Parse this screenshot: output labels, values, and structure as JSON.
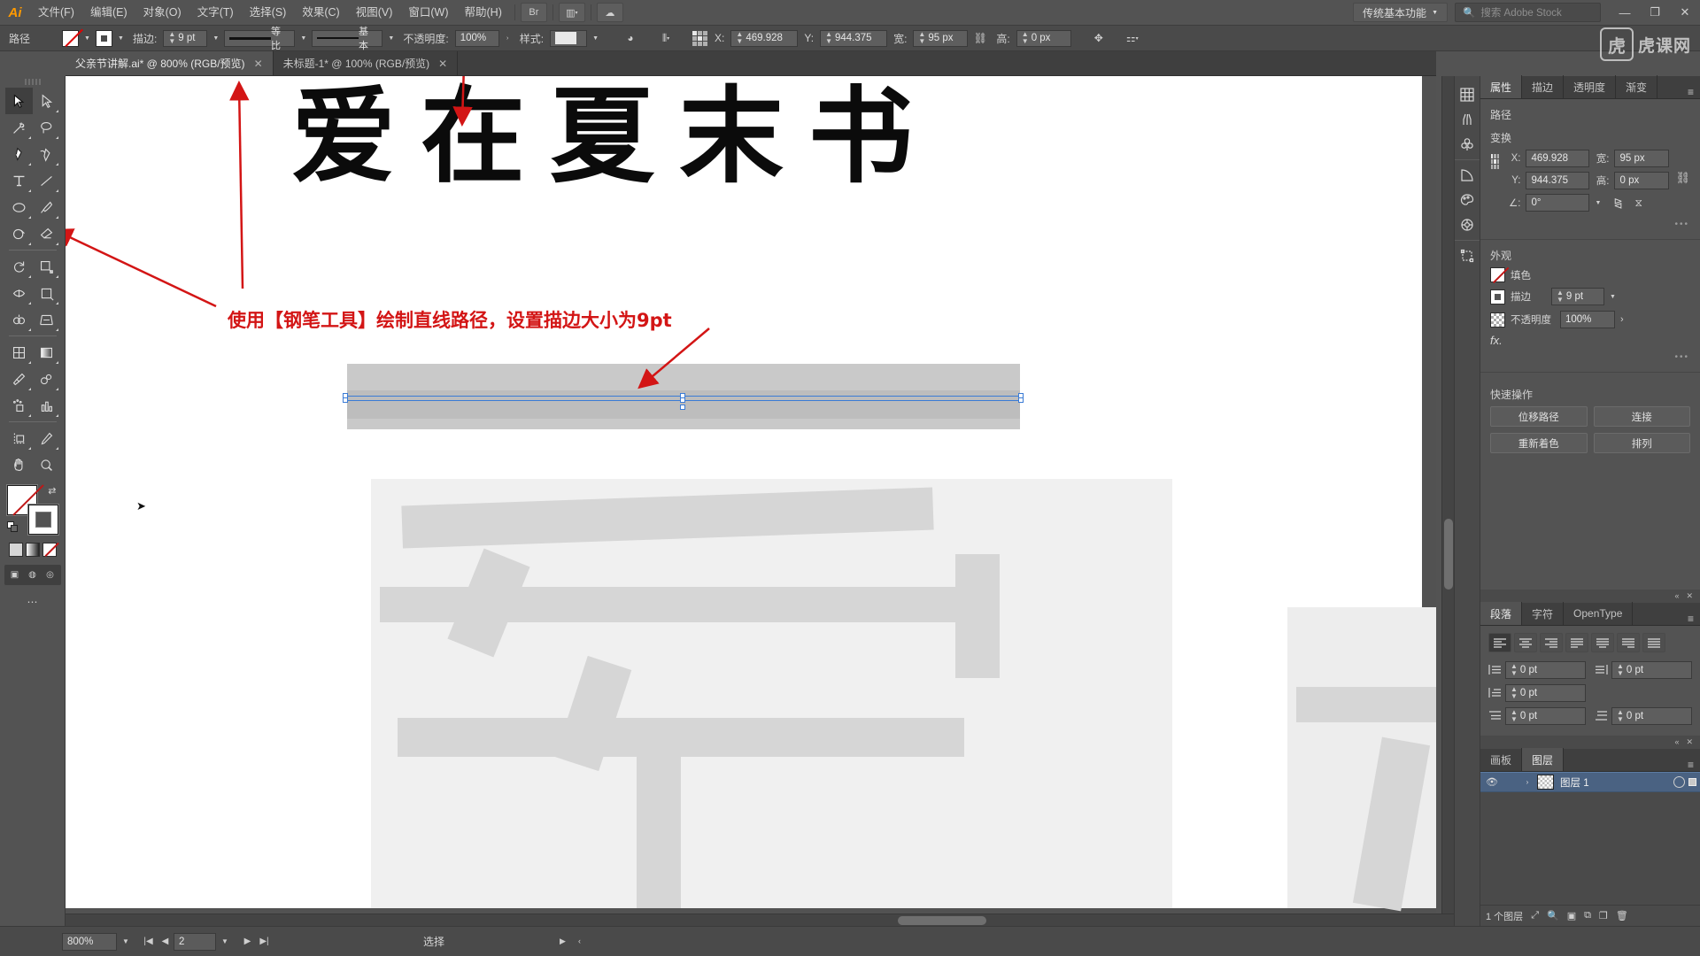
{
  "app": {
    "logo": "Ai",
    "menus": [
      "文件(F)",
      "编辑(E)",
      "对象(O)",
      "文字(T)",
      "选择(S)",
      "效果(C)",
      "视图(V)",
      "窗口(W)",
      "帮助(H)"
    ],
    "workspace": "传统基本功能",
    "stock_placeholder": "搜索 Adobe Stock",
    "win_min": "—",
    "win_max": "❐",
    "win_close": "✕"
  },
  "watermark": {
    "mark": "虎",
    "text": "虎课网"
  },
  "controlbar": {
    "object_label": "路径",
    "stroke_label": "描边:",
    "stroke_weight": "9 pt",
    "profile_variable": "等比",
    "brush_basic": "基本",
    "opacity_label": "不透明度:",
    "opacity_value": "100%",
    "style_label": "样式:",
    "x_label": "X:",
    "x_value": "469.928",
    "y_label": "Y:",
    "y_value": "944.375",
    "w_label": "宽:",
    "w_value": "95 px",
    "h_label": "高:",
    "h_value": "0 px"
  },
  "tabs": [
    {
      "title": "父亲节讲解.ai* @ 800% (RGB/预览)",
      "close": "✕",
      "active": true
    },
    {
      "title": "未标题-1* @ 100% (RGB/预览)",
      "close": "✕",
      "active": false
    }
  ],
  "toolbar": {
    "tools": [
      {
        "name": "selection-tool",
        "glyph": "sel",
        "active": true
      },
      {
        "name": "direct-selection-tool",
        "glyph": "dsel",
        "active": false
      },
      {
        "name": "magic-wand-tool",
        "glyph": "wand",
        "active": false
      },
      {
        "name": "lasso-tool",
        "glyph": "lasso",
        "active": false
      },
      {
        "name": "pen-tool",
        "glyph": "pen",
        "active": false
      },
      {
        "name": "curvature-tool",
        "glyph": "curv",
        "active": false
      },
      {
        "name": "type-tool",
        "glyph": "type",
        "active": false
      },
      {
        "name": "line-segment-tool",
        "glyph": "line",
        "active": false
      },
      {
        "name": "ellipse-tool",
        "glyph": "ellipse",
        "active": false
      },
      {
        "name": "paintbrush-tool",
        "glyph": "brush",
        "active": false
      },
      {
        "name": "shaper-tool",
        "glyph": "shaper",
        "active": false
      },
      {
        "name": "eraser-tool",
        "glyph": "eraser",
        "active": false
      },
      {
        "name": "rotate-tool",
        "glyph": "rotate",
        "active": false
      },
      {
        "name": "scale-tool",
        "glyph": "scale",
        "active": false
      },
      {
        "name": "width-tool",
        "glyph": "width",
        "active": false
      },
      {
        "name": "free-transform-tool",
        "glyph": "freetr",
        "active": false
      },
      {
        "name": "shape-builder-tool",
        "glyph": "shapeb",
        "active": false
      },
      {
        "name": "perspective-grid-tool",
        "glyph": "persp",
        "active": false
      },
      {
        "name": "mesh-tool",
        "glyph": "mesh",
        "active": false
      },
      {
        "name": "gradient-tool",
        "glyph": "grad",
        "active": false
      },
      {
        "name": "eyedropper-tool",
        "glyph": "eyedrop",
        "active": false
      },
      {
        "name": "blend-tool",
        "glyph": "blend",
        "active": false
      },
      {
        "name": "symbol-sprayer-tool",
        "glyph": "symbol",
        "active": false
      },
      {
        "name": "column-graph-tool",
        "glyph": "graph",
        "active": false
      },
      {
        "name": "artboard-tool",
        "glyph": "artboard",
        "active": false
      },
      {
        "name": "slice-tool",
        "glyph": "slice",
        "active": false
      },
      {
        "name": "hand-tool",
        "glyph": "hand",
        "active": false
      },
      {
        "name": "zoom-tool",
        "glyph": "zoom",
        "active": false
      }
    ]
  },
  "canvas": {
    "big_title": "爱在夏末书",
    "annotation": "使用【钢笔工具】绘制直线路径，设置描边大小为9pt"
  },
  "properties": {
    "tabs": [
      "属性",
      "描边",
      "透明度",
      "渐变"
    ],
    "active_tab": "属性",
    "object_type": "路径",
    "transform_title": "变换",
    "x_label": "X:",
    "x_value": "469.928",
    "y_label": "Y:",
    "y_value": "944.375",
    "w_label": "宽:",
    "w_value": "95 px",
    "h_label": "高:",
    "h_value": "0 px",
    "angle_label": "∠:",
    "angle_value": "0°",
    "appearance_title": "外观",
    "fill_label": "填色",
    "stroke_label": "描边",
    "stroke_value": "9 pt",
    "opacity_label": "不透明度",
    "opacity_value": "100%",
    "fx_label": "fx.",
    "quick_title": "快速操作",
    "quick_actions": [
      "位移路径",
      "连接",
      "重新着色",
      "排列"
    ]
  },
  "paragraph": {
    "tabs": [
      "段落",
      "字符",
      "OpenType"
    ],
    "active_tab": "段落",
    "indent_left": "0 pt",
    "indent_right": "0 pt",
    "indent_first": "0 pt",
    "space_before": "0 pt",
    "space_after": "0 pt"
  },
  "layers": {
    "tabs": [
      "画板",
      "图层"
    ],
    "active_tab": "图层",
    "rows": [
      {
        "name": "图层 1",
        "eye": "👁",
        "chevron": "›"
      }
    ],
    "count_text": "1 个图层"
  },
  "statusbar": {
    "zoom": "800%",
    "page": "2",
    "tool_text": "选择"
  },
  "rail": {
    "icons": [
      {
        "name": "swatches-panel-icon",
        "glyph": "sw"
      },
      {
        "name": "brushes-panel-icon",
        "glyph": "br"
      },
      {
        "name": "symbols-panel-icon",
        "glyph": "sy"
      },
      {
        "name": "stroke-panel-icon",
        "glyph": "st"
      },
      {
        "name": "color-panel-icon",
        "glyph": "co"
      },
      {
        "name": "color-guide-panel-icon",
        "glyph": "cg"
      },
      {
        "name": "transform-panel-icon",
        "glyph": "tr"
      }
    ]
  },
  "colors": {
    "chrome": "#535353",
    "panel": "#4a4a4a",
    "accent_blue": "#3a7bd5",
    "annotation_red": "#d31515",
    "layer_selected": "#4a6282"
  }
}
